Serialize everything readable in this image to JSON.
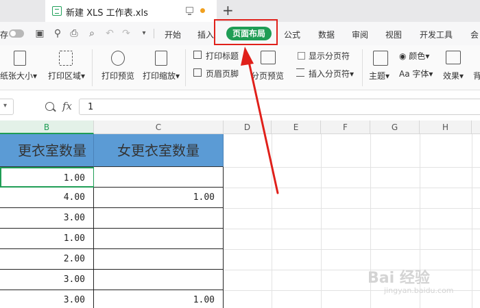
{
  "titlebar": {
    "tab_title": "新建 XLS 工作表.xls",
    "new_tab": "+"
  },
  "menubar": {
    "save_label": "存",
    "items": [
      "开始",
      "插入",
      "页面布局",
      "公式",
      "数据",
      "审阅",
      "视图",
      "开发工具",
      "会"
    ],
    "active_index": 2,
    "accent_color": "#1f9d55",
    "highlight_color": "#e0201a"
  },
  "ribbon": {
    "paper_size": "纸张大小",
    "print_area": "打印区域",
    "print_preview": "打印预览",
    "print_scale": "打印缩放",
    "print_titles": "打印标题",
    "header_footer": "页眉页脚",
    "page_break_preview": "分页预览",
    "show_page_breaks": "显示分页符",
    "insert_page_break": "插入分页符",
    "theme": "主题",
    "colors": "颜色",
    "fonts": "字体",
    "effects": "效果",
    "background": "背"
  },
  "formula": {
    "fx": "fx",
    "value": "1"
  },
  "grid": {
    "columns": [
      "B",
      "C",
      "D",
      "E",
      "F",
      "G",
      "H"
    ],
    "selected_column": "B",
    "headers": [
      "更衣室数量",
      "女更衣室数量"
    ],
    "header_color": "#5b9bd5",
    "rows": [
      [
        "1.00",
        ""
      ],
      [
        "4.00",
        "1.00"
      ],
      [
        "3.00",
        ""
      ],
      [
        "1.00",
        ""
      ],
      [
        "2.00",
        ""
      ],
      [
        "3.00",
        ""
      ],
      [
        "3.00",
        "1.00"
      ]
    ]
  },
  "watermark": {
    "text": "Bai 经验",
    "sub": "jingyan.baidu.com"
  }
}
